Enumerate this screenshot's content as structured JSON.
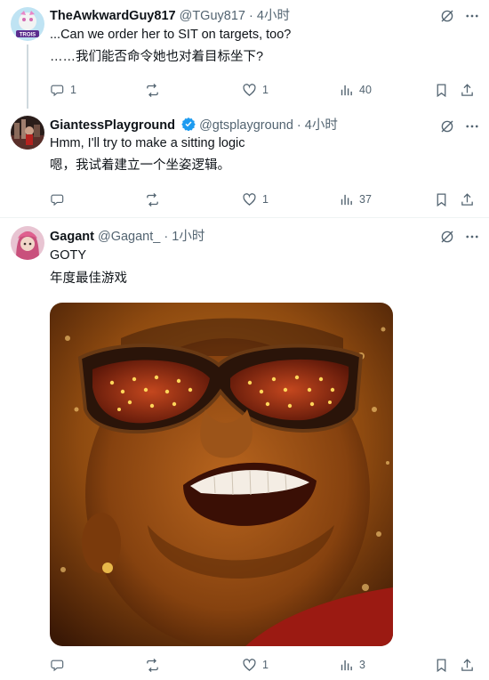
{
  "posts": [
    {
      "name": "TheAwkwardGuy817",
      "handle": "@TGuy817",
      "separator": "·",
      "time": "4小时",
      "text_line1": "...Can we order her to SIT on targets, too?",
      "text_line2": "……我们能否命令她也对着目标坐下?",
      "avatar_text": "TROIS",
      "replies": "1",
      "reposts": "",
      "likes": "1",
      "views": "40"
    },
    {
      "name": "GiantessPlayground",
      "verified": true,
      "handle": "@gtsplayground",
      "separator": "·",
      "time": "4小时",
      "text_line1": "Hmm, I'll try to make a sitting logic",
      "text_line2": "嗯，我试着建立一个坐姿逻辑。",
      "replies": "",
      "reposts": "",
      "likes": "1",
      "views": "37"
    },
    {
      "name": "Gagant",
      "handle": "@Gagant_",
      "separator": "·",
      "time": "1小时",
      "text_line1": "GOTY",
      "text_line2": "年度最佳游戏",
      "replies": "",
      "reposts": "",
      "likes": "1",
      "views": "3"
    }
  ],
  "colors": {
    "text": "#0f1419",
    "secondary": "#536471",
    "verified": "#1d9bf0",
    "thread_line": "#cfd9de",
    "divider": "#eff3f4"
  },
  "icons": [
    "grok-icon",
    "more-icon",
    "reply-icon",
    "repost-icon",
    "like-icon",
    "views-icon",
    "bookmark-icon",
    "share-icon",
    "verified-badge-icon"
  ]
}
